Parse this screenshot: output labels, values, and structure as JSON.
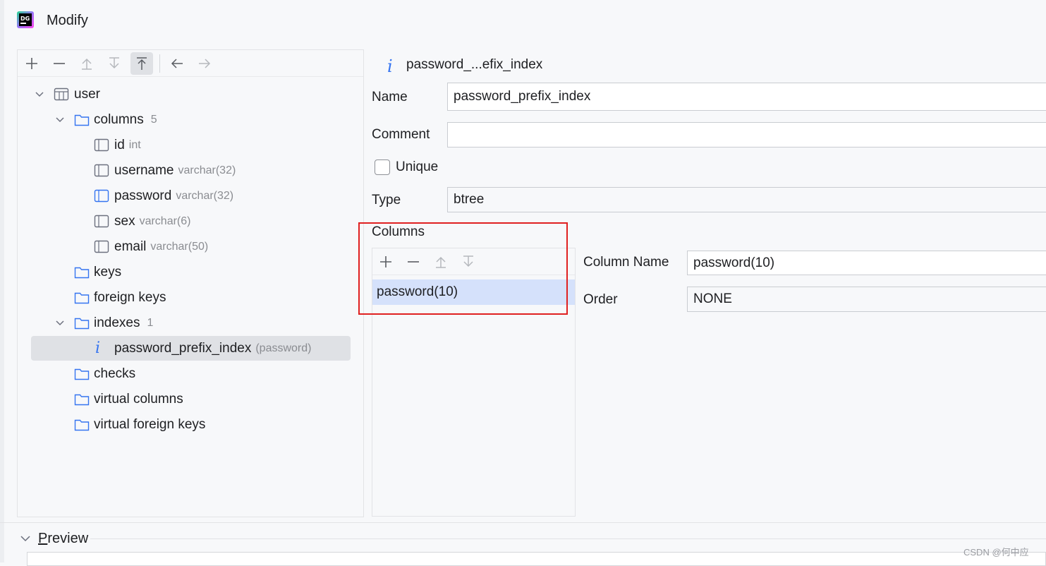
{
  "window": {
    "title": "Modify",
    "app_icon": "datagrip-logo"
  },
  "left_toolbar": {
    "buttons": [
      {
        "icon": "plus-icon"
      },
      {
        "icon": "minus-icon"
      },
      {
        "icon": "move-up-icon"
      },
      {
        "icon": "move-down-icon"
      },
      {
        "icon": "move-to-top-icon",
        "active": true
      },
      {
        "icon": "arrow-left-icon"
      },
      {
        "icon": "arrow-right-icon"
      }
    ]
  },
  "tree": {
    "table": {
      "label": "user"
    },
    "columns": {
      "label": "columns",
      "count": "5",
      "items": [
        {
          "label": "id",
          "type": "int"
        },
        {
          "label": "username",
          "type": "varchar(32)"
        },
        {
          "label": "password",
          "type": "varchar(32)"
        },
        {
          "label": "sex",
          "type": "varchar(6)"
        },
        {
          "label": "email",
          "type": "varchar(50)"
        }
      ]
    },
    "keys": {
      "label": "keys"
    },
    "foreign_keys": {
      "label": "foreign keys"
    },
    "indexes": {
      "label": "indexes",
      "count": "1",
      "items": [
        {
          "label": "password_prefix_index",
          "hint": "(password)",
          "icon_glyph": "i"
        }
      ]
    },
    "checks": {
      "label": "checks"
    },
    "virtual_columns": {
      "label": "virtual columns"
    },
    "virtual_foreign_keys": {
      "label": "virtual foreign keys"
    }
  },
  "detail": {
    "header_icon_glyph": "i",
    "header_title": "password_...efix_index",
    "name": {
      "label": "Name",
      "value": "password_prefix_index"
    },
    "comment": {
      "label": "Comment",
      "value": ""
    },
    "unique": {
      "label": "Unique",
      "checked": false
    },
    "type": {
      "label": "Type",
      "value": "btree"
    },
    "columns_section": {
      "label": "Columns",
      "items": [
        {
          "label": "password(10)"
        }
      ]
    },
    "column_name": {
      "label": "Column Name",
      "value": "password(10)"
    },
    "order": {
      "label": "Order",
      "value": "NONE"
    }
  },
  "preview": {
    "first_letter": "P",
    "rest": "review"
  },
  "watermark": "CSDN @何中应",
  "colors": {
    "accent": "#3574f0",
    "selection": "#d5e1fb",
    "highlight_box": "#e02020"
  }
}
